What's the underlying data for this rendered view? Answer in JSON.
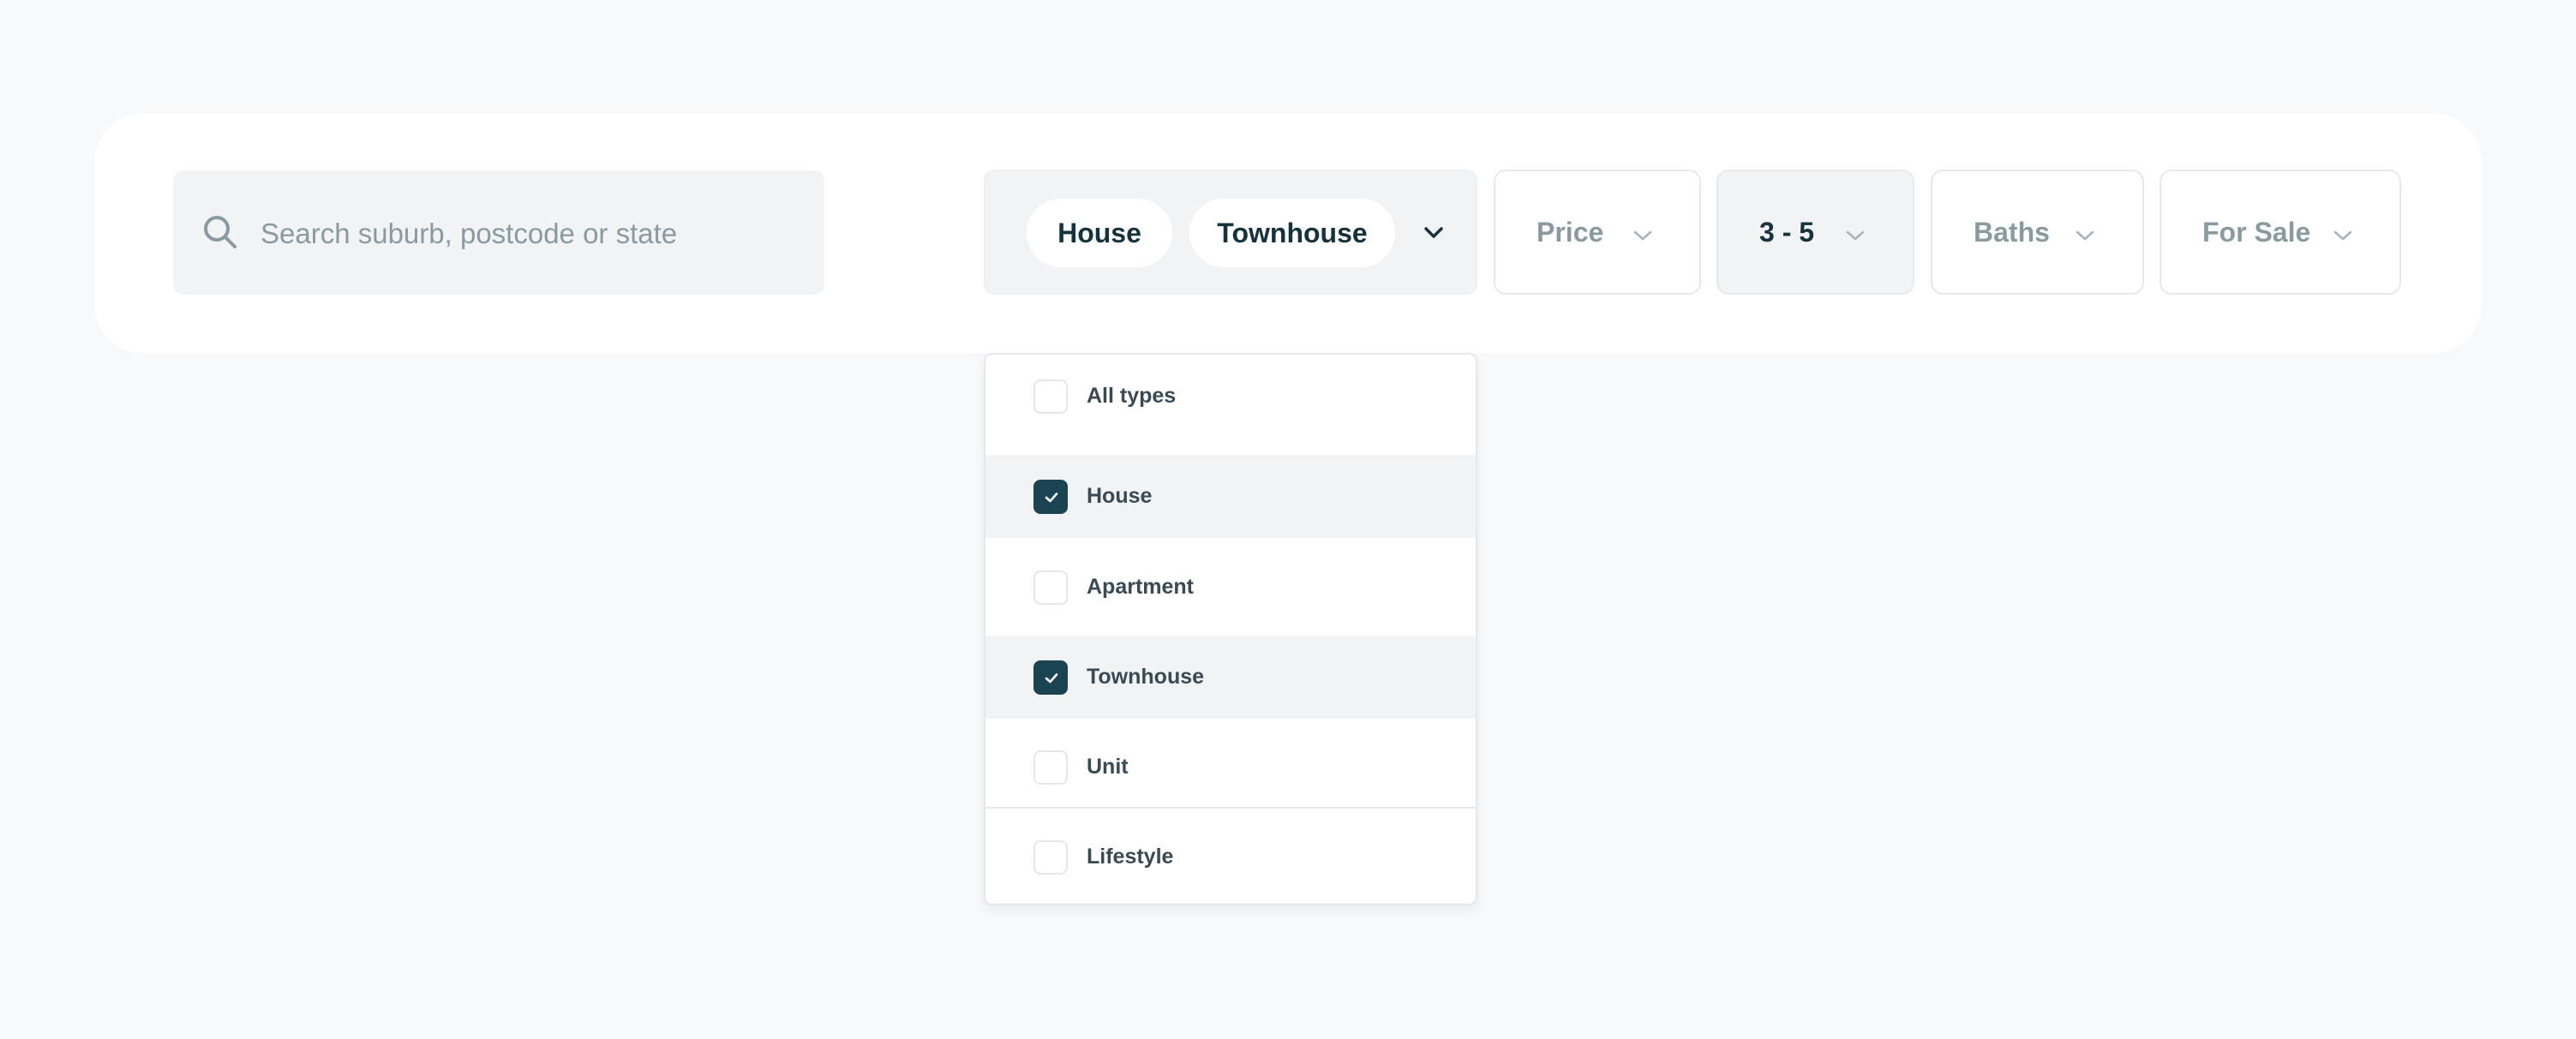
{
  "search": {
    "placeholder": "Search suburb, postcode or state",
    "value": ""
  },
  "property_type": {
    "selected_chips": [
      "House",
      "Townhouse"
    ],
    "options": [
      {
        "label": "All types",
        "checked": false
      },
      {
        "label": "House",
        "checked": true
      },
      {
        "label": "Apartment",
        "checked": false
      },
      {
        "label": "Townhouse",
        "checked": true
      },
      {
        "label": "Unit",
        "checked": false
      },
      {
        "label": "Lifestyle",
        "checked": false
      }
    ]
  },
  "filters": {
    "price_label": "Price",
    "beds_label": "3 - 5",
    "baths_label": "Baths",
    "listing_label": "For Sale"
  },
  "colors": {
    "accent": "#1b4452",
    "background": "#f8f9fa",
    "chip_text": "#16323c",
    "muted_text": "#8a9aa1"
  },
  "icons": {
    "search": "search-icon",
    "caret": "chevron-down-icon",
    "check": "check-icon"
  }
}
